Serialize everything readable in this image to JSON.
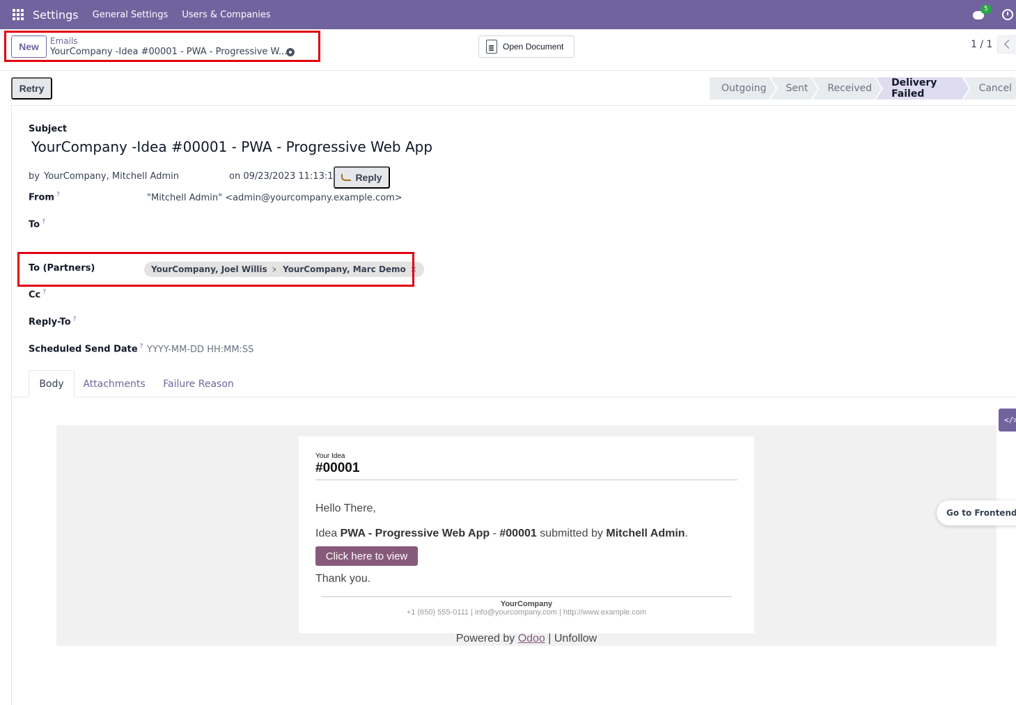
{
  "navbar": {
    "brand": "Settings",
    "menu": [
      "General Settings",
      "Users & Companies"
    ],
    "chat_badge": "5"
  },
  "control_panel": {
    "new_label": "New",
    "breadcrumb_parent": "Emails",
    "breadcrumb_current": "YourCompany -Idea #00001 - PWA - Progressive W...",
    "open_document_label": "Open Document",
    "pager": "1 / 1"
  },
  "statusbar": {
    "retry_label": "Retry",
    "stages": [
      {
        "label": "Outgoing",
        "active": false
      },
      {
        "label": "Sent",
        "active": false
      },
      {
        "label": "Received",
        "active": false
      },
      {
        "label": "Delivery Failed",
        "active": true
      },
      {
        "label": "Cancel",
        "active": false
      }
    ]
  },
  "form": {
    "subject_label": "Subject",
    "subject": "YourCompany -Idea  #00001 - PWA - Progressive Web App",
    "by_prefix": "by",
    "author": "YourCompany, Mitchell Admin",
    "date_text": "on 09/23/2023 11:13:14",
    "reply_label": "Reply",
    "from_label": "From",
    "from_value": "\"Mitchell Admin\" <admin@yourcompany.example.com>",
    "to_label": "To",
    "to_partners_label": "To (Partners)",
    "partners": [
      "YourCompany, Joel Willis",
      "YourCompany, Marc Demo"
    ],
    "tag_remove": "×",
    "cc_label": "Cc",
    "reply_to_label": "Reply-To",
    "scheduled_label": "Scheduled Send Date",
    "scheduled_placeholder": "YYYY-MM-DD HH:MM:SS",
    "help_mark": "?"
  },
  "tabs": [
    "Body",
    "Attachments",
    "Failure Reason"
  ],
  "mail": {
    "small_title": "Your Idea",
    "number": "#00001",
    "hello": "Hello There,",
    "idea_prefix": "Idea ",
    "idea_name": "PWA - Progressive Web App",
    "idea_sep": " - ",
    "idea_num": "#00001",
    "submitted_by": " submitted by ",
    "submitter": "Mitchell Admin",
    "period": ".",
    "button": "Click here to view",
    "thanks": "Thank you.",
    "company": "YourCompany",
    "contact": "+1 (650) 555-0111 | info@yourcompany.com | http://www.example.com",
    "powered_prefix": "Powered by ",
    "powered_link": "Odoo",
    "powered_sep": " | ",
    "unfollow": "Unfollow"
  },
  "side": {
    "code_toggle": "</>",
    "go_frontend": "Go to Frontend"
  },
  "colors": {
    "brand": "#71639e",
    "highlight": "#e0000f",
    "mail_button": "#875a7b"
  }
}
